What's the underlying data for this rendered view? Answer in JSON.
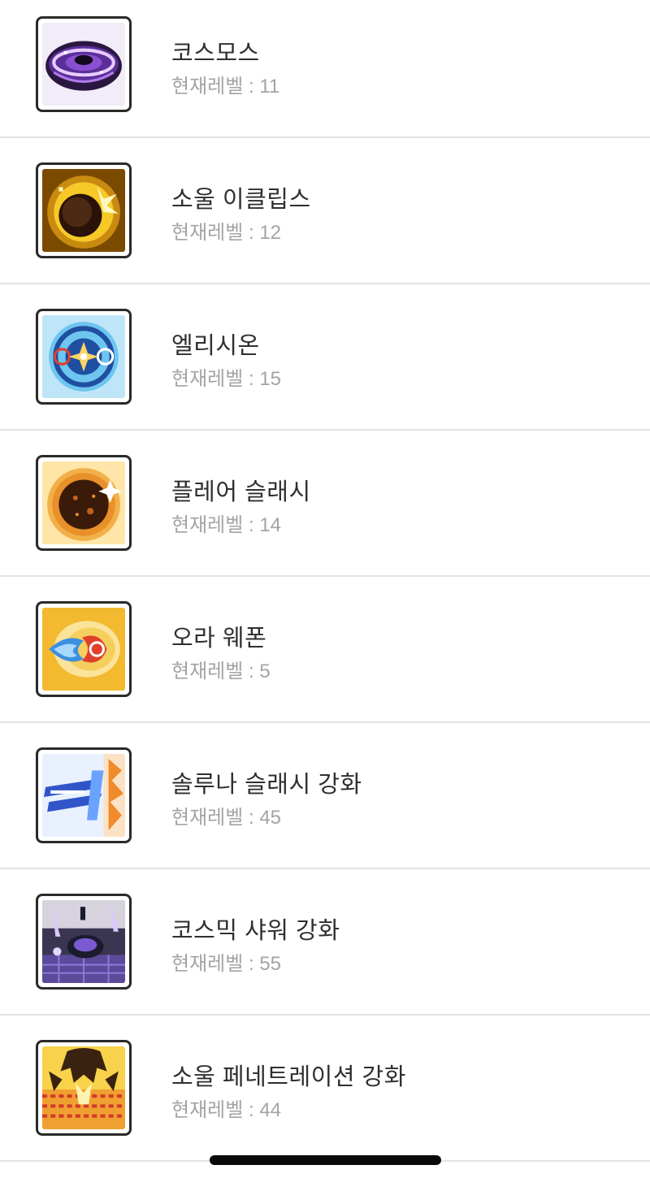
{
  "skills": [
    {
      "name": "코스모스",
      "level_label": "현재레벨 : 11",
      "icon": "cosmos-icon",
      "colors": [
        "#2a1740",
        "#8a4fd1",
        "#e8ccff"
      ]
    },
    {
      "name": "소울 이클립스",
      "level_label": "현재레벨 : 12",
      "icon": "soul-eclipse-icon",
      "colors": [
        "#7a4a00",
        "#f6c928",
        "#fff6c0"
      ]
    },
    {
      "name": "엘리시온",
      "level_label": "현재레벨 : 15",
      "icon": "elysion-icon",
      "colors": [
        "#1f4fa0",
        "#6ec5ef",
        "#ffd566"
      ]
    },
    {
      "name": "플레어 슬래시",
      "level_label": "현재레벨 : 14",
      "icon": "flare-slash-icon",
      "colors": [
        "#3a1a08",
        "#e8902a",
        "#ffe6a8"
      ]
    },
    {
      "name": "오라 웨폰",
      "level_label": "현재레벨 : 5",
      "icon": "aura-weapon-icon",
      "colors": [
        "#f3b92f",
        "#3d8fe0",
        "#e0402a"
      ]
    },
    {
      "name": "솔루나 슬래시 강화",
      "level_label": "현재레벨 : 45",
      "icon": "soluna-slash-icon",
      "colors": [
        "#2f55c8",
        "#e9f1ff",
        "#f08a2a"
      ]
    },
    {
      "name": "코스믹 샤워 강화",
      "level_label": "현재레벨 : 55",
      "icon": "cosmic-shower-icon",
      "colors": [
        "#1b1b2e",
        "#7a5ad0",
        "#d9c8ff"
      ]
    },
    {
      "name": "소울 페네트레이션 강화",
      "level_label": "현재레벨 : 44",
      "icon": "soul-penetration-icon",
      "colors": [
        "#3a2210",
        "#f0c830",
        "#d23a2a"
      ]
    }
  ]
}
